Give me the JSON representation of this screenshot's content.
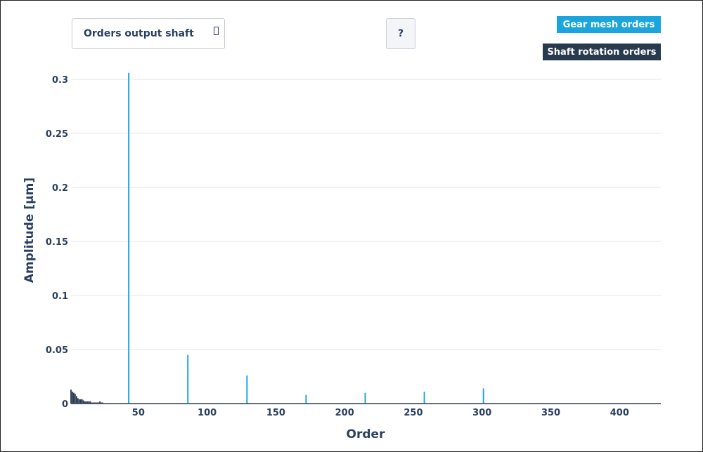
{
  "controls": {
    "dropdown_label": "Orders output shaft",
    "help_label": "?"
  },
  "legend": {
    "gear_mesh": "Gear mesh orders",
    "shaft_rotation": "Shaft rotation orders"
  },
  "colors": {
    "gear_mesh": "#1ca5dc",
    "shaft_rotation": "#283a4e",
    "grid": "#e2e5ea",
    "axis": "#2a3f5f"
  },
  "chart_data": {
    "type": "bar",
    "xlabel": "Order",
    "ylabel": "Amplitude [µm]",
    "xlim": [
      1,
      430
    ],
    "ylim": [
      0,
      0.3
    ],
    "x_ticks": [
      50,
      100,
      150,
      200,
      250,
      300,
      350,
      400
    ],
    "y_ticks": [
      0,
      0.05,
      0.1,
      0.15,
      0.2,
      0.25,
      0.3
    ],
    "y_tick_labels": [
      "0",
      "0.05",
      "0.1",
      "0.15",
      "0.2",
      "0.25",
      "0.3"
    ],
    "grid": true,
    "legend_position": "top-right",
    "series": [
      {
        "name": "Gear mesh orders",
        "x": [
          43,
          86,
          129,
          172,
          215,
          258,
          301
        ],
        "values": [
          0.306,
          0.045,
          0.026,
          0.008,
          0.01,
          0.011,
          0.014
        ]
      },
      {
        "name": "Shaft rotation orders",
        "x": [
          1,
          2,
          3,
          4,
          5,
          6,
          7,
          8,
          9,
          10,
          11,
          12,
          13,
          14,
          15,
          16,
          17,
          18,
          19,
          20,
          21,
          22,
          23,
          24
        ],
        "values": [
          0.013,
          0.011,
          0.01,
          0.009,
          0.007,
          0.005,
          0.004,
          0.004,
          0.004,
          0.003,
          0.002,
          0.002,
          0.002,
          0.002,
          0.002,
          0.001,
          0.001,
          0.001,
          0.001,
          0.001,
          0.001,
          0.002,
          0.001,
          0.001
        ]
      }
    ]
  }
}
